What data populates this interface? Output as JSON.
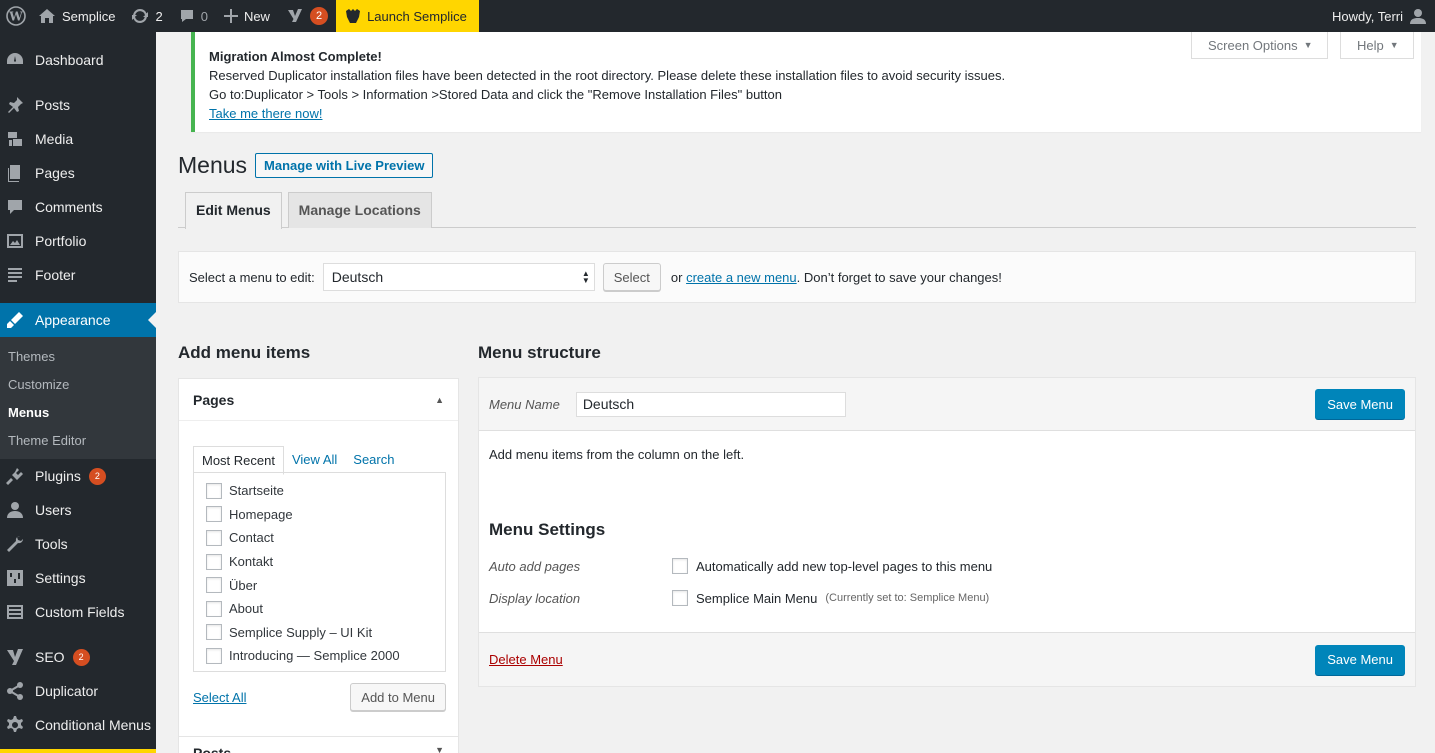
{
  "adminbar": {
    "site_name": "Semplice",
    "updates_count": "2",
    "comments_count": "0",
    "new_label": "New",
    "yoast_badge": "2",
    "launch_label": "Launch Semplice",
    "howdy": "Howdy, Terri"
  },
  "sidebar": {
    "items": [
      {
        "label": "Dashboard",
        "icon": "dashboard-icon"
      },
      {
        "label": "Posts",
        "icon": "pin-icon"
      },
      {
        "label": "Media",
        "icon": "media-icon"
      },
      {
        "label": "Pages",
        "icon": "pages-icon"
      },
      {
        "label": "Comments",
        "icon": "comments-icon"
      },
      {
        "label": "Portfolio",
        "icon": "portfolio-icon"
      },
      {
        "label": "Footer",
        "icon": "footer-icon"
      },
      {
        "label": "Appearance",
        "icon": "appearance-icon"
      }
    ],
    "submenu": [
      "Themes",
      "Customize",
      "Menus",
      "Theme Editor"
    ],
    "items_after": [
      {
        "label": "Plugins",
        "badge": "2"
      },
      {
        "label": "Users"
      },
      {
        "label": "Tools"
      },
      {
        "label": "Settings"
      },
      {
        "label": "Custom Fields"
      },
      {
        "label": "SEO",
        "badge": "2"
      },
      {
        "label": "Duplicator"
      },
      {
        "label": "Conditional Menus"
      }
    ]
  },
  "notice": {
    "title": "Migration Almost Complete!",
    "line1": "Reserved Duplicator installation files have been detected in the root directory. Please delete these installation files to avoid security issues.",
    "line2": "Go to:Duplicator > Tools > Information >Stored Data and click the \"Remove Installation Files\" button",
    "link": "Take me there now!"
  },
  "top_buttons": {
    "screen_options": "Screen Options",
    "help": "Help"
  },
  "page": {
    "title": "Menus",
    "live_preview": "Manage with Live Preview",
    "tabs": [
      "Edit Menus",
      "Manage Locations"
    ]
  },
  "select_bar": {
    "label": "Select a menu to edit:",
    "selected": "Deutsch",
    "button": "Select",
    "or": "or",
    "create_link": "create a new menu",
    "suffix": ". Don’t forget to save your changes!"
  },
  "add_items": {
    "title": "Add menu items",
    "pages_title": "Pages",
    "subtabs": [
      "Most Recent",
      "View All",
      "Search"
    ],
    "pages": [
      "Startseite",
      "Homepage",
      "Contact",
      "Kontakt",
      "Über",
      "About",
      "Semplice Supply – UI Kit",
      "Introducing — Semplice 2000"
    ],
    "select_all": "Select All",
    "add_button": "Add to Menu",
    "posts_title": "Posts"
  },
  "structure": {
    "title": "Menu structure",
    "name_label": "Menu Name",
    "name_value": "Deutsch",
    "save": "Save Menu",
    "hint": "Add menu items from the column on the left.",
    "settings_title": "Menu Settings",
    "auto_add_label": "Auto add pages",
    "auto_add_text": "Automatically add new top-level pages to this menu",
    "display_label": "Display location",
    "display_text": "Semplice Main Menu",
    "display_note": "(Currently set to: Semplice Menu)",
    "delete": "Delete Menu"
  }
}
